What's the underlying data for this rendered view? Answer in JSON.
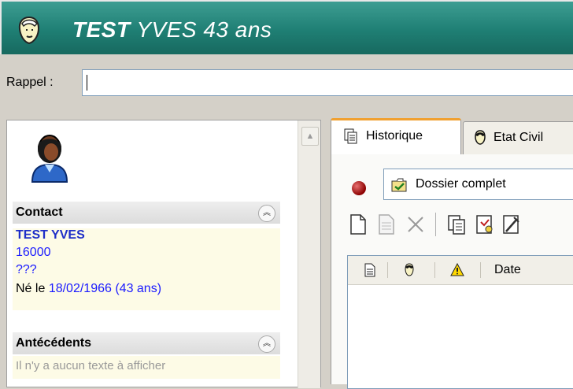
{
  "window": {
    "title_bold": "TEST",
    "title_rest": "YVES 43 ans",
    "icon": "patient-head-icon"
  },
  "rappel": {
    "label": "Rappel :",
    "value": ""
  },
  "left_panel": {
    "avatar_icon": "patient-avatar-icon",
    "contact": {
      "header": "Contact",
      "name": "TEST YVES",
      "postal": "16000",
      "city": "???",
      "born_prefix": "Né le",
      "born_date": "18/02/1966 (43 ans)"
    },
    "antecedents": {
      "header": "Antécédents",
      "empty_text": "Il n'y a aucun texte à afficher"
    }
  },
  "right_panel": {
    "tabs": [
      {
        "label": "Historique",
        "icon": "history-icon",
        "active": true
      },
      {
        "label": "Etat Civil",
        "icon": "civil-status-icon",
        "active": false
      }
    ],
    "selector": {
      "value": "Dossier complet",
      "icon": "folder-check-icon"
    },
    "status_indicator_color": "#8b0000",
    "toolbar": [
      "new-document-icon",
      "document-icon",
      "delete-icon",
      "copy-icon",
      "template-icon",
      "edit-template-icon"
    ],
    "list_columns": [
      "doc-icon",
      "person-icon",
      "warning-icon",
      "Date"
    ]
  },
  "colors": {
    "titlebar": "#1f7f74",
    "contact_bg": "#fdfbe6",
    "link_blue": "#1a1aff"
  }
}
